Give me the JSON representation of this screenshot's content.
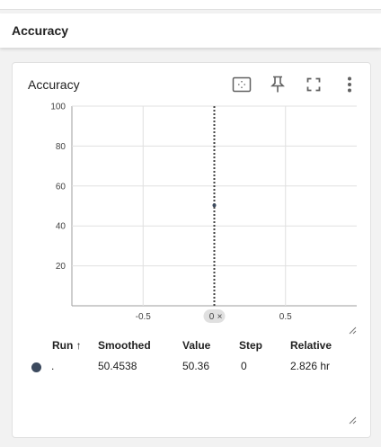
{
  "section": {
    "title": "Accuracy"
  },
  "card": {
    "title": "Accuracy",
    "toolbar": [
      "fit-domain-icon",
      "pin-icon",
      "fullscreen-icon",
      "more-vert-icon"
    ]
  },
  "chart_data": {
    "type": "line",
    "title": "",
    "xlabel": "",
    "ylabel": "",
    "x_ticks": [
      "-0.5",
      "0.5"
    ],
    "y_ticks": [
      "100",
      "80",
      "60",
      "40",
      "20"
    ],
    "xlim": [
      -1,
      1
    ],
    "ylim": [
      0,
      100
    ],
    "grid": true,
    "hover_x": {
      "value": 0,
      "label": "0"
    },
    "series": [
      {
        "x": [
          0
        ],
        "y": [
          50.36
        ],
        "color": "#3c4a5e"
      }
    ]
  },
  "table": {
    "headers": {
      "run": "Run ↑",
      "smoothed": "Smoothed",
      "value": "Value",
      "step": "Step",
      "relative": "Relative"
    },
    "rows": [
      {
        "run": ".",
        "smoothed": "50.4538",
        "value": "50.36",
        "step": "0",
        "relative": "2.826 hr",
        "color": "#3c4a5e"
      }
    ]
  }
}
